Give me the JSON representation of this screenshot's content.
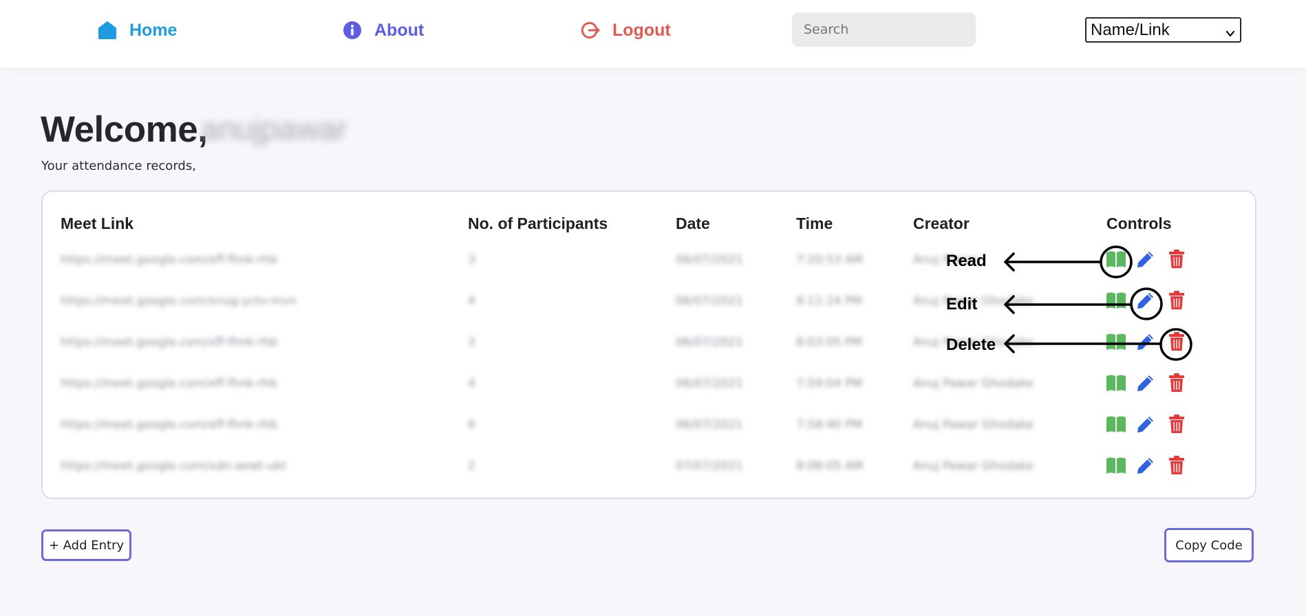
{
  "nav": {
    "home_label": "Home",
    "about_label": "About",
    "logout_label": "Logout",
    "search_placeholder": "Search",
    "filter_selected": "Name/Link",
    "colors": {
      "home": "#1f9be0",
      "about": "#5b5ee0",
      "logout": "#e05a52"
    },
    "icons": {
      "home": "home-icon",
      "about": "info-icon",
      "logout": "logout-icon"
    }
  },
  "main": {
    "welcome": "Welcome,",
    "username": "anujpawar",
    "subtitle": "Your attendance records,"
  },
  "table": {
    "headers": [
      "Meet Link",
      "No. of Participants",
      "Date",
      "Time",
      "Creator",
      "Controls"
    ],
    "rows": [
      {
        "link": "https://meet.google.com/xff-fhnk-rhb",
        "participants": "3",
        "date": "06/07/2021",
        "time": "7:20:53 AM",
        "creator": "Anuj Pawar"
      },
      {
        "link": "https://meet.google.com/xnug-yctv-mvn",
        "participants": "4",
        "date": "06/07/2021",
        "time": "9:11:24 PM",
        "creator": "Anuj Pawar Ghodake"
      },
      {
        "link": "https://meet.google.com/xff-fhnk-rhb",
        "participants": "3",
        "date": "06/07/2021",
        "time": "8:03:05 PM",
        "creator": "Anuj Pawar Ghodake"
      },
      {
        "link": "https://meet.google.com/xff-fhnk-rhb",
        "participants": "4",
        "date": "06/07/2021",
        "time": "7:59:04 PM",
        "creator": "Anuj Pawar Ghodake"
      },
      {
        "link": "https://meet.google.com/xff-fhnk-rhb",
        "participants": "6",
        "date": "06/07/2021",
        "time": "7:58:40 PM",
        "creator": "Anuj Pawar Ghodake"
      },
      {
        "link": "https://meet.google.com/xdn-aewt-ukt",
        "participants": "2",
        "date": "07/07/2021",
        "time": "8:08:05 AM",
        "creator": "Anuj Pawar Ghodake"
      }
    ],
    "control_icons": [
      "book-icon",
      "pencil-icon",
      "trash-icon"
    ],
    "control_colors": {
      "read": "#5cb85c",
      "edit": "#2f63e0",
      "delete": "#e63a3a"
    }
  },
  "annotations": {
    "read": "Read",
    "edit": "Edit",
    "delete": "Delete"
  },
  "footer": {
    "add_entry": "+ Add Entry",
    "copy_code": "Copy Code"
  }
}
